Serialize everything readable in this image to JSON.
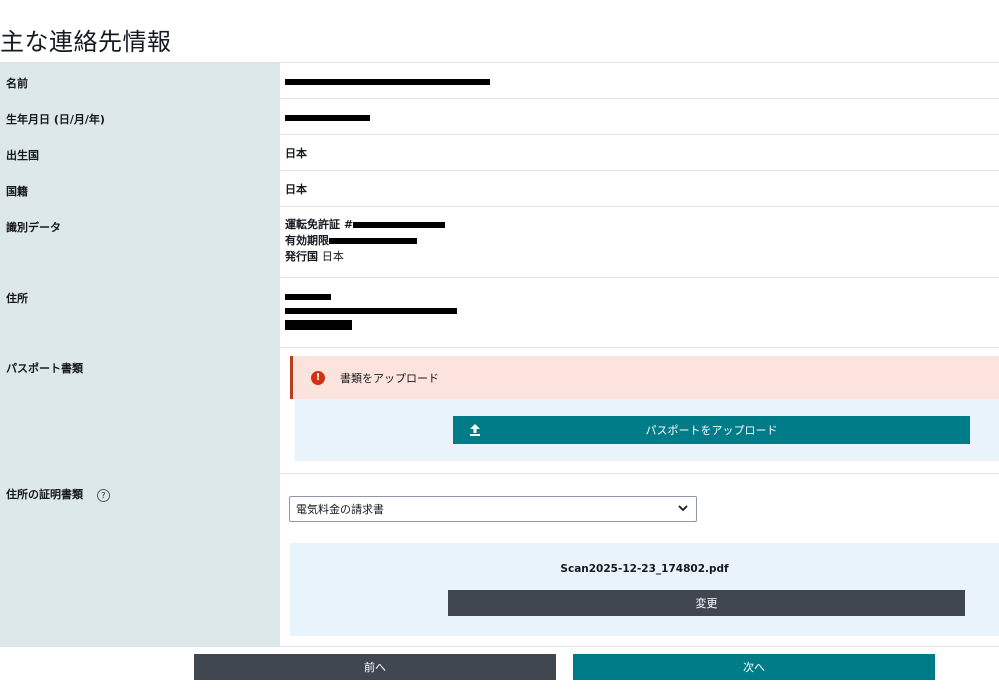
{
  "page": {
    "title": "主な連絡先情報"
  },
  "rows": {
    "name": {
      "label": "名前"
    },
    "dob": {
      "label": "生年月日 (日/月/年)"
    },
    "birth_country": {
      "label": "出生国",
      "value": "日本"
    },
    "nationality": {
      "label": "国籍",
      "value": "日本"
    },
    "id_data": {
      "label": "識別データ",
      "license_label": "運転免許証 #",
      "expiry_label": "有効期限",
      "issuing_country_label": "発行国",
      "issuing_country_value": "日本"
    },
    "address": {
      "label": "住所"
    },
    "passport": {
      "label": "パスポート書類",
      "alert_text": "書類をアップロード",
      "upload_button": "パスポートをアップロード"
    },
    "address_proof": {
      "label": "住所の証明書類",
      "selected_option": "電気料金の請求書",
      "file_name": "Scan2025-12-23_174802.pdf",
      "change_button": "変更"
    }
  },
  "nav": {
    "prev": "前へ",
    "next": "次へ"
  },
  "icons": {
    "alert": "exclamation-circle-icon",
    "upload": "upload-arrow-icon",
    "help": "question-circle-icon",
    "select": "chevron-down-icon"
  },
  "colors": {
    "label_bg": "#dde8ea",
    "primary": "#007c89",
    "secondary": "#414750",
    "alert_bg": "#fde3de",
    "alert_icon": "#d13212",
    "panel_bg": "#e8f3fb"
  }
}
